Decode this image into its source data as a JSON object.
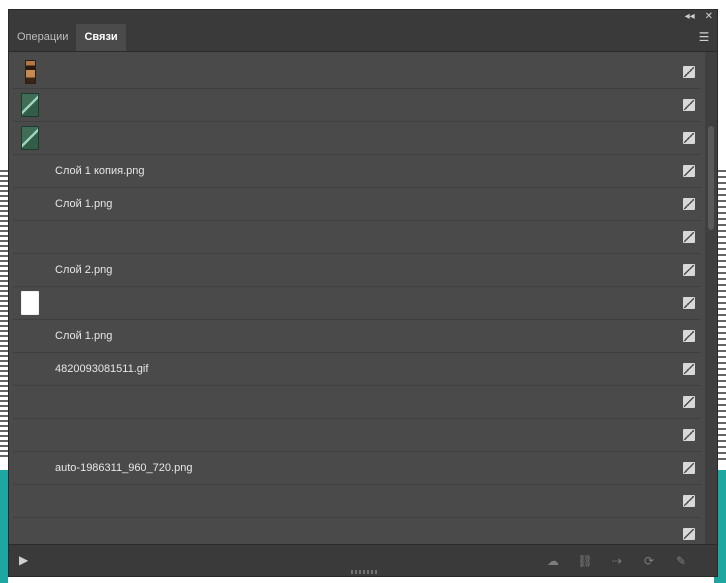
{
  "panel": {
    "controls": {
      "collapse": "◂◂",
      "close": "✕"
    },
    "tabs": [
      {
        "label": "Операции",
        "active": false
      },
      {
        "label": "Связи",
        "active": true
      }
    ],
    "menu_icon": "☰"
  },
  "links": {
    "rows": [
      {
        "thumb": "bottle",
        "name": ""
      },
      {
        "thumb": "green",
        "name": ""
      },
      {
        "thumb": "green",
        "name": ""
      },
      {
        "thumb": "",
        "name": "Слой 1 копия.png"
      },
      {
        "thumb": "",
        "name": "Слой 1.png"
      },
      {
        "thumb": "",
        "name": ""
      },
      {
        "thumb": "",
        "name": "Слой 2.png"
      },
      {
        "thumb": "white",
        "name": ""
      },
      {
        "thumb": "",
        "name": "Слой 1.png"
      },
      {
        "thumb": "",
        "name": "4820093081511.gif"
      },
      {
        "thumb": "",
        "name": ""
      },
      {
        "thumb": "",
        "name": ""
      },
      {
        "thumb": "",
        "name": "auto-1986311_960_720.png"
      },
      {
        "thumb": "",
        "name": ""
      },
      {
        "thumb": "",
        "name": ""
      }
    ]
  },
  "bottombar": {
    "play_icon": "▶",
    "tool_icons": [
      "relink-icon",
      "link-icon",
      "goto-link-icon",
      "update-link-icon",
      "edit-original-icon"
    ]
  }
}
